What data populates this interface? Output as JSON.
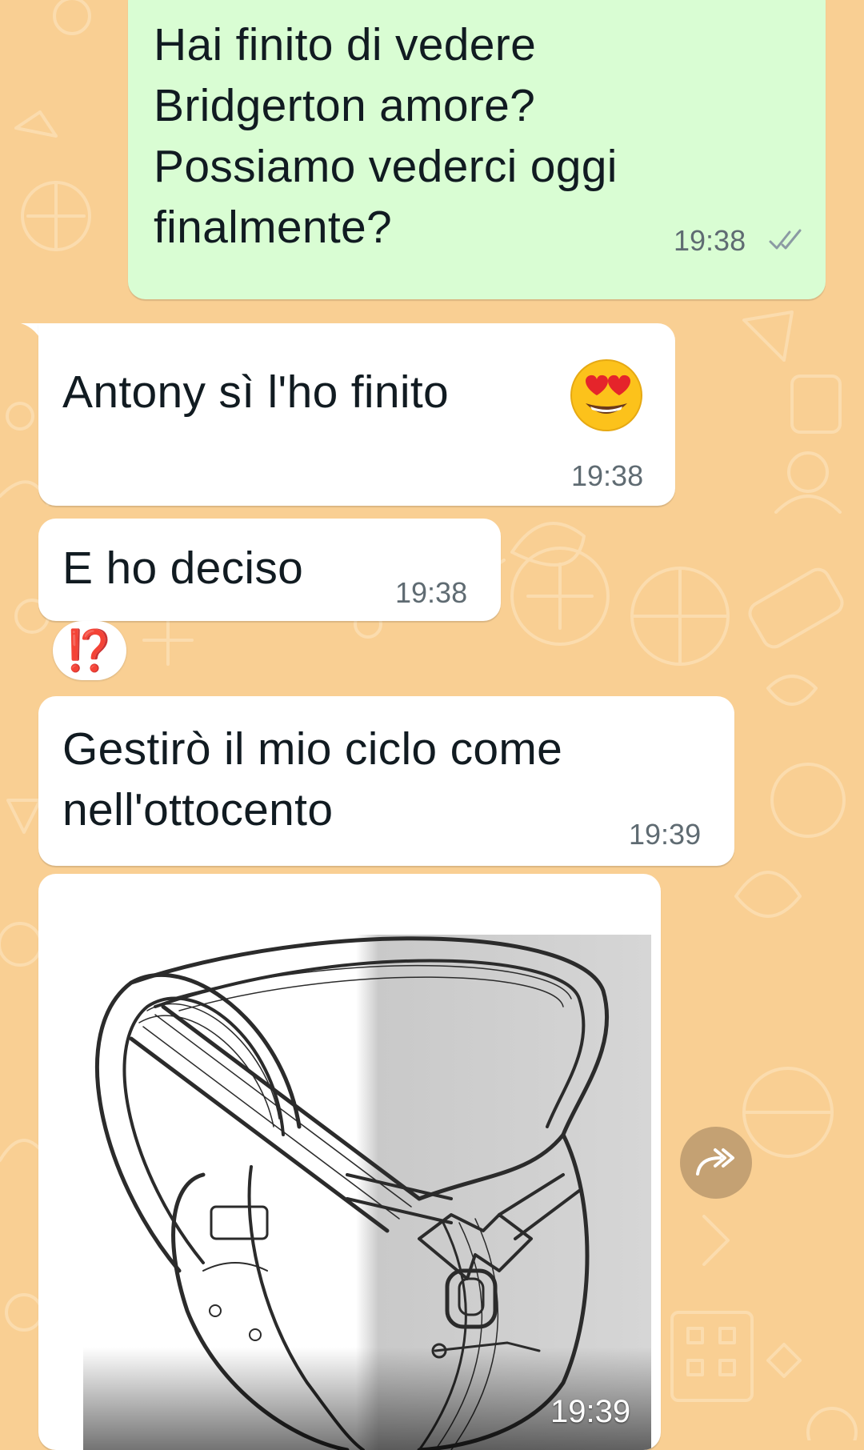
{
  "messages": [
    {
      "direction": "outgoing",
      "text": "Hai finito di vedere\nBridgerton amore?\nPossiamo vederci oggi\nfinalmente?",
      "time": "19:38",
      "status": "read-double-check"
    },
    {
      "direction": "incoming",
      "text": "Antony sì l'ho finito",
      "emoji": "heart-eyes-emoji",
      "time": "19:38"
    },
    {
      "direction": "incoming",
      "text": "E ho deciso",
      "time": "19:38",
      "reaction": "⁉️"
    },
    {
      "direction": "incoming",
      "text": "Gestirò il mio ciclo come\nnell'ottocento",
      "time": "19:39"
    },
    {
      "direction": "incoming",
      "type": "image",
      "image_description_icon": "vintage-belt-illustration",
      "time": "19:39"
    }
  ],
  "actions": {
    "forward_icon": "forward-arrow-icon"
  },
  "colors": {
    "wallpaper": "#f9cf93",
    "outgoing_bubble": "#d9fdd3",
    "incoming_bubble": "#ffffff",
    "read_ticks": "#8b9aa3",
    "reaction_red": "#e5242b"
  }
}
